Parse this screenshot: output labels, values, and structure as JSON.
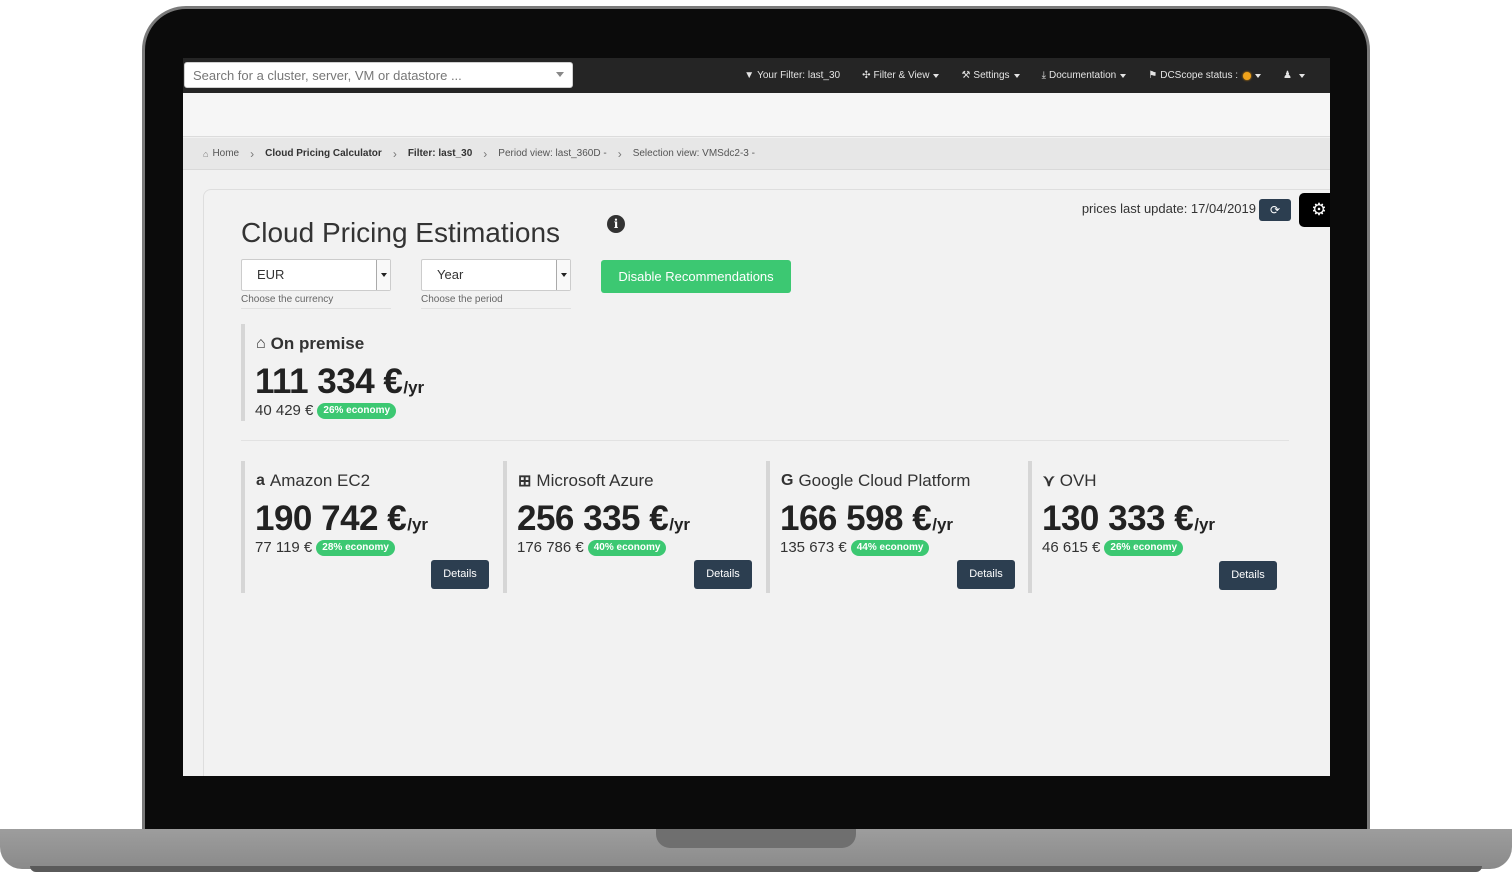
{
  "topbar": {
    "search_placeholder": "Search for a cluster, server, VM or datastore ...",
    "filter_label": "Your Filter: last_30",
    "filter_view_label": "Filter & View",
    "settings_label": "Settings",
    "documentation_label": "Documentation",
    "status_label": "DCScope status :"
  },
  "breadcrumb": {
    "home": "Home",
    "calculator": "Cloud Pricing Calculator",
    "filter": "Filter: last_30",
    "period_view": "Period view: last_360D -",
    "selection_view": "Selection view: VMSdc2-3 -"
  },
  "main": {
    "title": "Cloud Pricing Estimations",
    "prices_update": "prices last update: 17/04/2019",
    "currency": {
      "value": "EUR",
      "help": "Choose the currency"
    },
    "period": {
      "value": "Year",
      "help": "Choose the period"
    },
    "recommend_button": "Disable Recommendations"
  },
  "on_premise": {
    "title": "On premise",
    "price": "111 334 €",
    "unit": "/yr",
    "sub": "40 429 €",
    "badge": "26% economy"
  },
  "providers": [
    {
      "name": "Amazon EC2",
      "icon": "amazon-icon",
      "price": "190 742 €",
      "unit": "/yr",
      "sub": "77 119 €",
      "badge": "28% economy",
      "details": "Details"
    },
    {
      "name": "Microsoft Azure",
      "icon": "windows-icon",
      "price": "256 335 €",
      "unit": "/yr",
      "sub": "176 786 €",
      "badge": "40% economy",
      "details": "Details"
    },
    {
      "name": "Google Cloud Platform",
      "icon": "google-icon",
      "price": "166 598 €",
      "unit": "/yr",
      "sub": "135 673 €",
      "badge": "44% economy",
      "details": "Details"
    },
    {
      "name": "OVH",
      "icon": "ovh-icon",
      "price": "130 333 €",
      "unit": "/yr",
      "sub": "46 615 €",
      "badge": "26% economy",
      "details": "Details"
    }
  ],
  "colors": {
    "accent_green": "#3cc872",
    "button_dark": "#2c3e50",
    "topbar": "#252525"
  }
}
